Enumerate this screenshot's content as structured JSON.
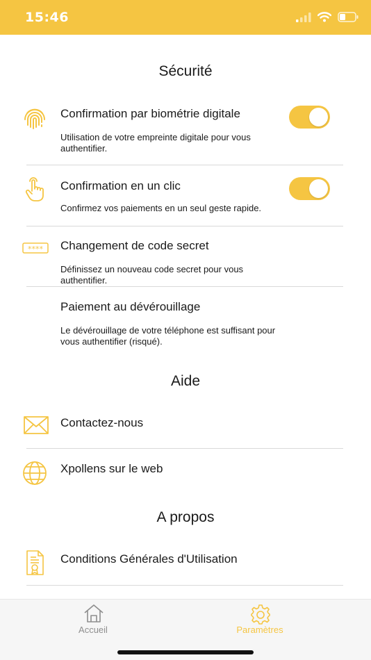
{
  "status_bar": {
    "time": "15:46"
  },
  "sections": {
    "security": {
      "title": "Sécurité",
      "items": [
        {
          "title": "Confirmation par biométrie digitale",
          "description": "Utilisation de votre empreinte digitale pour vous authentifier.",
          "icon": "fingerprint-icon",
          "toggle": true
        },
        {
          "title": "Confirmation en un clic",
          "description": "Confirmez vos paiements en un seul geste rapide.",
          "icon": "tap-hand-icon",
          "toggle": true
        },
        {
          "title": "Changement de code secret",
          "description": "Définissez un nouveau code secret pour vous authentifier.",
          "icon": "pin-code-icon"
        },
        {
          "title": "Paiement au dévérouillage",
          "description": "Le dévérouillage de votre téléphone est suffisant pour vous authentifier (risqué)."
        }
      ]
    },
    "help": {
      "title": "Aide",
      "items": [
        {
          "title": "Contactez-nous",
          "icon": "envelope-icon"
        },
        {
          "title": "Xpollens sur le web",
          "icon": "globe-icon"
        }
      ]
    },
    "about": {
      "title": "A propos",
      "items": [
        {
          "title": "Conditions Générales d'Utilisation",
          "icon": "certificate-icon"
        }
      ]
    }
  },
  "tab_bar": {
    "tabs": [
      {
        "label": "Accueil",
        "icon": "home-icon",
        "active": false
      },
      {
        "label": "Paramètres",
        "icon": "gear-icon",
        "active": true
      }
    ]
  },
  "colors": {
    "accent": "#f5c542",
    "text": "#1a1a1a",
    "inactive_tab": "#8e8e8e",
    "divider": "#d9d9d9"
  }
}
